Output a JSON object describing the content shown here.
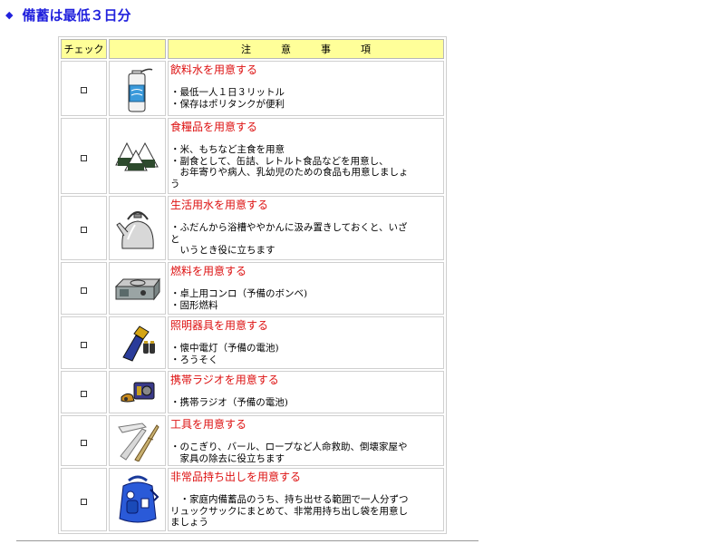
{
  "heading": {
    "bullet": "◆",
    "text": "備蓄は最低３日分"
  },
  "table": {
    "headers": {
      "check": "チェック",
      "image": "",
      "notes": "注　　　意　　　事　　　項"
    },
    "rows": [
      {
        "icon": "water-bottle-icon",
        "title": "飲料水を用意する",
        "lines": [
          "・最低一人１日３リットル",
          "・保存はポリタンクが便利"
        ]
      },
      {
        "icon": "rice-ball-icon",
        "title": "食糧品を用意する",
        "lines": [
          "・米、もちなど主食を用意",
          "・副食として、缶詰、レトルト食品などを用意し、",
          "　お年寄りや病人、乳幼児のための食品も用意しましょ",
          "う"
        ]
      },
      {
        "icon": "kettle-icon",
        "title": "生活用水を用意する",
        "lines": [
          "・ふだんから浴槽ややかんに汲み置きしておくと、いざ",
          "と",
          "　いうとき役に立ちます"
        ]
      },
      {
        "icon": "portable-stove-icon",
        "title": "燃料を用意する",
        "lines": [
          "・卓上用コンロ（予備のボンベ)",
          "・固形燃料"
        ]
      },
      {
        "icon": "flashlight-icon",
        "title": "照明器具を用意する",
        "lines": [
          "・懐中電灯（予備の電池)",
          "・ろうそく"
        ]
      },
      {
        "icon": "radio-icon",
        "title": "携帯ラジオを用意する",
        "lines": [
          "・携帯ラジオ（予備の電池)"
        ]
      },
      {
        "icon": "tools-icon",
        "title": "工具を用意する",
        "lines": [
          "・のこぎり、バール、ロープなど人命救助、倒壊家屋や",
          "　家具の除去に役立ちます"
        ]
      },
      {
        "icon": "backpack-icon",
        "title": "非常品持ち出しを用意する",
        "lines": [
          "　・家庭内備蓄品のうち、持ち出せる範囲で一人分ずつ",
          "リュックサックにまとめて、非常用持ち出し袋を用意し",
          "ましょう"
        ]
      }
    ]
  }
}
